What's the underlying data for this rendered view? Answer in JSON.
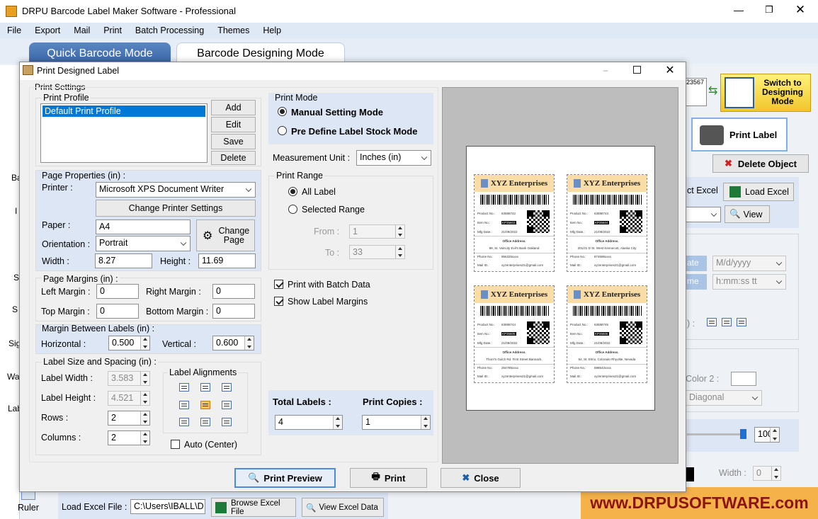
{
  "app": {
    "title": "DRPU Barcode Label Maker Software - Professional",
    "menu": [
      "File",
      "Export",
      "Mail",
      "Print",
      "Batch Processing",
      "Themes",
      "Help"
    ],
    "modes": {
      "quick": "Quick Barcode Mode",
      "designing": "Barcode Designing Mode"
    },
    "switch_btn": "Switch to Designing Mode",
    "print_label_btn": "Print Label",
    "delete_object_btn": "Delete Object",
    "load_excel_btn": "Load Excel",
    "view_btn": "View",
    "partial_excel": "ct Excel",
    "date_label": "ate",
    "date_format": "M/d/yyyy",
    "time_label": "me",
    "time_format": "h:mm:ss tt",
    "color2_label": "Color 2 :",
    "diagonal": "Diagonal",
    "slider_value": "100",
    "width_label": "Width :",
    "width_value": "0",
    "left_side": [
      "Ba",
      "I",
      "S",
      "S",
      "Sig",
      "Wa",
      "Lab"
    ],
    "ruler": "Ruler",
    "load_excel_file_label": "Load Excel File :",
    "excel_path": "C:\\Users\\IBALL\\D",
    "browse_excel": "Browse Excel File",
    "view_excel_data": "View Excel Data",
    "watermark": "www.DRPUSOFTWARE.com"
  },
  "dialog": {
    "title": "Print Designed Label",
    "print_settings": "Print Settings",
    "print_profile": "Print Profile",
    "profiles": [
      "Default Print Profile"
    ],
    "profile_buttons": {
      "add": "Add",
      "edit": "Edit",
      "save": "Save",
      "delete": "Delete"
    },
    "page_properties": "Page Properties (in) :",
    "printer_label": "Printer :",
    "printer_value": "Microsoft XPS Document Writer",
    "change_printer": "Change Printer Settings",
    "paper_label": "Paper :",
    "paper_value": "A4",
    "change_page": "Change Page",
    "orientation_label": "Orientation :",
    "orientation_value": "Portrait",
    "width_label": "Width :",
    "width_value": "8.27",
    "height_label": "Height :",
    "height_value": "11.69",
    "page_margins": "Page Margins (in) :",
    "left_margin_label": "Left Margin :",
    "left_margin": "0",
    "right_margin_label": "Right Margin :",
    "right_margin": "0",
    "top_margin_label": "Top Margin :",
    "top_margin": "0",
    "bottom_margin_label": "Bottom Margin :",
    "bottom_margin": "0",
    "margin_between": "Margin Between Labels (in) :",
    "horizontal_label": "Horizontal :",
    "horizontal": "0.500",
    "vertical_label": "Vertical :",
    "vertical": "0.600",
    "size_spacing": "Label Size and Spacing (in) :",
    "label_width_label": "Label Width :",
    "label_width": "3.583",
    "label_height_label": "Label Height :",
    "label_height": "4.521",
    "rows_label": "Rows :",
    "rows": "2",
    "columns_label": "Columns :",
    "columns": "2",
    "alignments": "Label Alignments",
    "auto_center": "Auto (Center)",
    "print_mode": "Print Mode",
    "manual_mode": "Manual Setting Mode",
    "predefine_mode": "Pre Define Label Stock Mode",
    "measurement_label": "Measurement Unit :",
    "measurement_value": "Inches (in)",
    "print_range": "Print Range",
    "all_label": "All Label",
    "selected_range": "Selected Range",
    "from_label": "From :",
    "from_value": "1",
    "to_label": "To :",
    "to_value": "33",
    "batch_data": "Print with Batch Data",
    "show_margins": "Show Label Margins",
    "total_labels_label": "Total Labels :",
    "total_labels": "4",
    "print_copies_label": "Print Copies :",
    "print_copies": "1",
    "print_preview": "Print Preview",
    "print": "Print",
    "close": "Close"
  },
  "labels": [
    {
      "company": "XYZ Enterprises",
      "product_label": "Product No.:",
      "product": "63598742",
      "item_label": "Item No.:",
      "item": "KP35603",
      "mfg_label": "Mfg Date.:",
      "mfg": "21/09/2022",
      "office": "Office Address.",
      "address": "89, St. Vaincity Evil's Bank Oakland",
      "phone_label": "Phone No.:",
      "phone": "956325xxxx",
      "mail_label": "Mail ID.:",
      "mail": "xyzenterprises21@gmail.com"
    },
    {
      "company": "XYZ Enterprises",
      "product_label": "Product No.:",
      "product": "63598743",
      "item_label": "Item No.:",
      "item": "KP35604",
      "mfg_label": "Mfg Date.:",
      "mfg": "21/09/2022",
      "office": "Office Address.",
      "address": "201/31 D St. West Kennecott, Alaska City",
      "phone_label": "Phone No.:",
      "phone": "874596xxxx",
      "mail_label": "Mail ID.:",
      "mail": "xyzenterprises21@gmail.com"
    },
    {
      "company": "XYZ Enterprises",
      "product_label": "Product No.:",
      "product": "63598744",
      "item_label": "Item No.:",
      "item": "KP35605",
      "mfg_label": "Mfg Date.:",
      "mfg": "21/09/2022",
      "office": "Office Address.",
      "address": "Thorn's Gulch Rd. First Street Bannack,",
      "phone_label": "Phone No.:",
      "phone": "254785xxxx",
      "mail_label": "Mail ID.:",
      "mail": "xyzenterprises21@gmail.com"
    },
    {
      "company": "XYZ Enterprises",
      "product_label": "Product No.:",
      "product": "63598745",
      "item_label": "Item No.:",
      "item": "KP35606",
      "mfg_label": "Mfg Date.:",
      "mfg": "21/09/2022",
      "office": "Office Address.",
      "address": "54, St. Elmo, Colorado Rhyolite, Nevada",
      "phone_label": "Phone No.:",
      "phone": "698542xxxx",
      "mail_label": "Mail ID.:",
      "mail": "xyzenterprises21@gmail.com"
    }
  ]
}
